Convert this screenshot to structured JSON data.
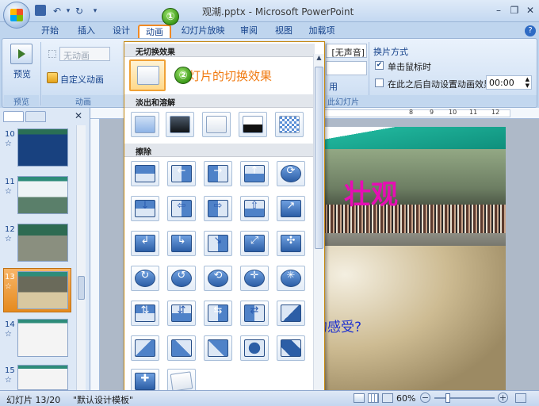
{
  "window": {
    "title": "观潮.pptx - Microsoft PowerPoint"
  },
  "tabs": [
    "开始",
    "插入",
    "设计",
    "动画",
    "幻灯片放映",
    "审阅",
    "视图",
    "加载项"
  ],
  "ribbon": {
    "preview": {
      "button_label": "预览",
      "group_label": "预览"
    },
    "animation": {
      "dropdown_value": "无动画",
      "custom_anim_label": "自定义动画",
      "group_label": "动画"
    },
    "transition": {
      "sound_value": "[无声音]",
      "speed_label_partial": "用",
      "group_label_partial": "此幻灯片",
      "advance_title": "换片方式",
      "on_click_label": "单击鼠标时",
      "on_click_checked": true,
      "auto_label": "在此之后自动设置动画效果:",
      "auto_checked": false,
      "auto_time": "00:00"
    }
  },
  "gallery": {
    "section_none": "无切换效果",
    "section_fade": "淡出和溶解",
    "section_wipe": "擦除",
    "annotation_1": "①",
    "annotation_2": "②",
    "callout": "幻灯片的切换效果"
  },
  "slides": [
    {
      "num": "10",
      "star": "☆"
    },
    {
      "num": "11",
      "star": "☆"
    },
    {
      "num": "12",
      "star": "☆"
    },
    {
      "num": "13",
      "star": "☆"
    },
    {
      "num": "14",
      "star": "☆"
    },
    {
      "num": "15",
      "star": "☆"
    }
  ],
  "slide": {
    "heading": "壮观",
    "body_partial": "的感受?"
  },
  "status": {
    "slide_info": "幻灯片 13/20",
    "theme": "\"默认设计模板\"",
    "zoom": "60%"
  },
  "ruler_marks": [
    "8",
    "9",
    "10",
    "11",
    "12"
  ],
  "colors": {
    "accent": "#f08a24",
    "ribbon": "#d4e3f5",
    "heading": "#e60eb4"
  }
}
